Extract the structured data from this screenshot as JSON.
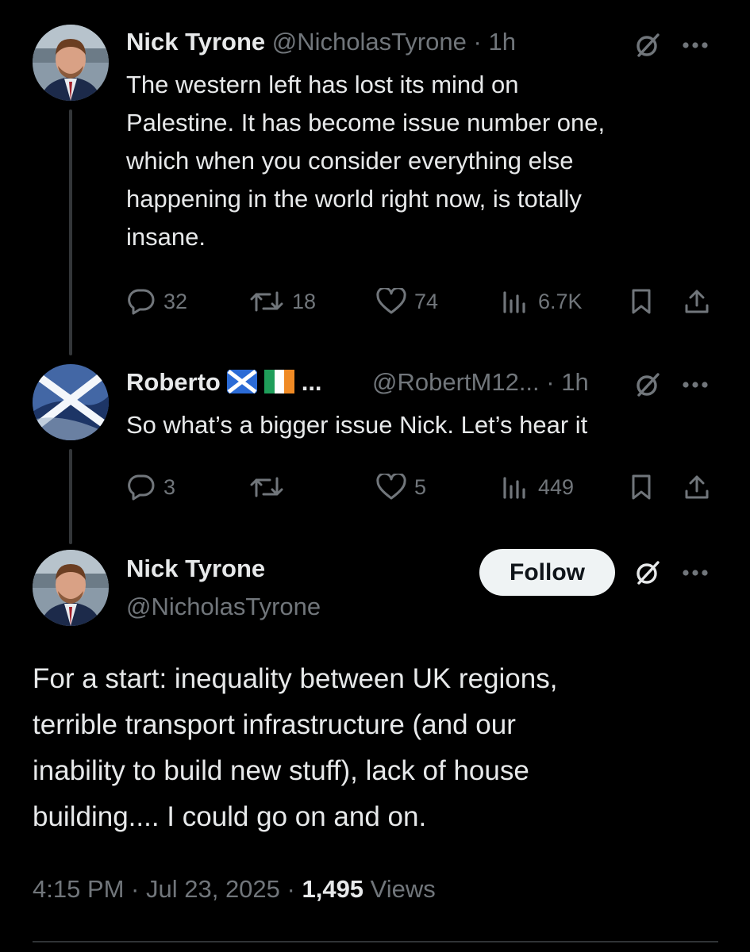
{
  "tweet1": {
    "name": "Nick Tyrone",
    "handle": "@NicholasTyrone",
    "time": "· 1h",
    "text_lines": [
      "The western left has lost its mind on",
      "Palestine. It has become issue number one,",
      "which when you consider everything else",
      "happening in the world right now, is totally",
      "insane."
    ],
    "replies": "32",
    "reposts": "18",
    "likes": "74",
    "views": "6.7K"
  },
  "tweet2": {
    "name": "Roberto",
    "name_suffix": "...",
    "handle": "@RobertM12...",
    "time": "· 1h",
    "text": "So what’s a bigger issue Nick.  Let’s hear it",
    "replies": "3",
    "reposts": "",
    "likes": "5",
    "views": "449"
  },
  "main": {
    "name": "Nick Tyrone",
    "handle": "@NicholasTyrone",
    "follow_label": "Follow",
    "text_lines": [
      "For a start: inequality between UK regions,",
      "terrible transport infrastructure (and our",
      "inability to build new stuff), lack of house",
      "building.... I could go on and on."
    ],
    "time": "4:15 PM · Jul 23, 2025 ·",
    "views_count": "1,495",
    "views_label": "Views"
  },
  "icons": {
    "reply": "speech-bubble-icon",
    "repost": "repost-arrows-icon",
    "like": "heart-icon",
    "views": "bar-chart-icon",
    "bookmark": "bookmark-icon",
    "share": "share-upload-icon",
    "grok": "slashed-circle-icon",
    "more": "ellipsis-icon"
  },
  "colors": {
    "background": "#000000",
    "text": "#e7e9ea",
    "muted": "#71767b",
    "follow_bg": "#eff3f4"
  }
}
